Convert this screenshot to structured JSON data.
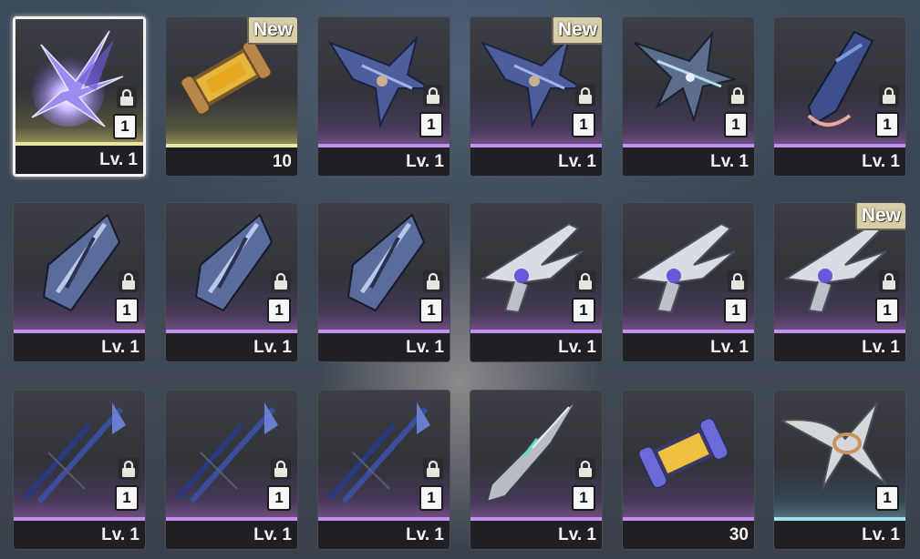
{
  "inventory": {
    "items": [
      {
        "name": "star-crystal-weapon",
        "footer": "Lv. 1",
        "badge": "1",
        "locked": true,
        "new": false,
        "rarity": "gold",
        "selected": true,
        "art": "crystal"
      },
      {
        "name": "gold-capsule",
        "footer": "10",
        "badge": "",
        "locked": false,
        "new": true,
        "new_label": "New",
        "rarity": "gold",
        "selected": false,
        "art": "capsule-gold"
      },
      {
        "name": "blue-crossbow",
        "footer": "Lv. 1",
        "badge": "1",
        "locked": true,
        "new": false,
        "rarity": "purple",
        "selected": false,
        "art": "crossbow"
      },
      {
        "name": "blue-crossbow",
        "footer": "Lv. 1",
        "badge": "1",
        "locked": true,
        "new": true,
        "new_label": "New",
        "rarity": "purple",
        "selected": false,
        "art": "crossbow"
      },
      {
        "name": "steel-crossbow",
        "footer": "Lv. 1",
        "badge": "1",
        "locked": true,
        "new": false,
        "rarity": "purple",
        "selected": false,
        "art": "crossbow2"
      },
      {
        "name": "blue-gauntlet",
        "footer": "Lv. 1",
        "badge": "1",
        "locked": true,
        "new": false,
        "rarity": "purple",
        "selected": false,
        "art": "gauntlet"
      },
      {
        "name": "shield-blade",
        "footer": "Lv. 1",
        "badge": "1",
        "locked": true,
        "new": false,
        "rarity": "purple",
        "selected": false,
        "art": "shield"
      },
      {
        "name": "shield-blade",
        "footer": "Lv. 1",
        "badge": "1",
        "locked": true,
        "new": false,
        "rarity": "purple",
        "selected": false,
        "art": "shield"
      },
      {
        "name": "shield-blade",
        "footer": "Lv. 1",
        "badge": "1",
        "locked": true,
        "new": false,
        "rarity": "purple",
        "selected": false,
        "art": "shield"
      },
      {
        "name": "white-pistol",
        "footer": "Lv. 1",
        "badge": "1",
        "locked": true,
        "new": false,
        "rarity": "purple",
        "selected": false,
        "art": "pistol"
      },
      {
        "name": "white-pistol",
        "footer": "Lv. 1",
        "badge": "1",
        "locked": true,
        "new": false,
        "rarity": "purple",
        "selected": false,
        "art": "pistol"
      },
      {
        "name": "white-pistol",
        "footer": "Lv. 1",
        "badge": "1",
        "locked": true,
        "new": true,
        "new_label": "New",
        "rarity": "purple",
        "selected": false,
        "art": "pistol"
      },
      {
        "name": "blue-spear",
        "footer": "Lv. 1",
        "badge": "1",
        "locked": true,
        "new": false,
        "rarity": "purple",
        "selected": false,
        "art": "spear"
      },
      {
        "name": "blue-spear",
        "footer": "Lv. 1",
        "badge": "1",
        "locked": true,
        "new": false,
        "rarity": "purple",
        "selected": false,
        "art": "spear"
      },
      {
        "name": "blue-spear",
        "footer": "Lv. 1",
        "badge": "1",
        "locked": true,
        "new": false,
        "rarity": "purple",
        "selected": false,
        "art": "spear"
      },
      {
        "name": "silver-lance",
        "footer": "Lv. 1",
        "badge": "1",
        "locked": true,
        "new": false,
        "rarity": "purple",
        "selected": false,
        "art": "lance"
      },
      {
        "name": "purple-capsule",
        "footer": "30",
        "badge": "",
        "locked": false,
        "new": false,
        "rarity": "purple",
        "selected": false,
        "art": "capsule-purple"
      },
      {
        "name": "bone-wings",
        "footer": "Lv. 1",
        "badge": "1",
        "locked": false,
        "new": false,
        "rarity": "blue",
        "selected": false,
        "art": "wings"
      }
    ]
  },
  "colors": {
    "purple": "#c58ef0",
    "gold": "#e9e6a3",
    "blue": "#9fe3f8"
  }
}
